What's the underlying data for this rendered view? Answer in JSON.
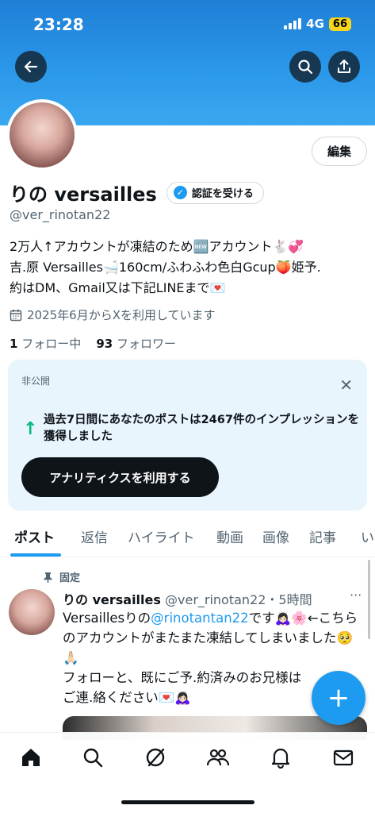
{
  "status_bar": {
    "time": "23:28",
    "network": "4G",
    "battery": "66"
  },
  "header_icons": {
    "back": "back-arrow-icon",
    "search": "search-icon",
    "share": "share-icon"
  },
  "profile": {
    "edit_label": "編集",
    "display_name": "りの versailles",
    "verify_label": "認証を受ける",
    "handle": "@ver_rinotan22",
    "bio_line1": "2万人↑アカウントが凍結のため🆕アカウント🐇💞",
    "bio_line2": "吉.原 Versailles🛁160cm/ふわふわ色白Gcup🍑姫予.",
    "bio_line3": "約はDM、Gmail又は下記LINEまで💌",
    "joined": "2025年6月からXを利用しています",
    "following_count": "1",
    "following_label": "フォロー中",
    "followers_count": "93",
    "followers_label": "フォロワー"
  },
  "analytics_card": {
    "private_label": "非公開",
    "message": "過去7日間にあなたのポストは2467件のインプレッションを獲得しました",
    "button_label": "アナリティクスを利用する"
  },
  "tabs": [
    "ポスト",
    "返信",
    "ハイライト",
    "動画",
    "画像",
    "記事",
    "い"
  ],
  "pinned_post": {
    "pinned_label": "固定",
    "name": "りの versailles",
    "handle_time": "@ver_rinotan22・5時間",
    "more": "···",
    "text_before": "Versaillesりの",
    "mention": "@rinotantan22",
    "text_after": "です🙇🏻‍♀️🌸←こちらのアカウントがまたまた凍結してしまいました🥺🙏🏻",
    "text_line2": "フォローと、既にご予.約済みのお兄様は",
    "text_line3": "ご連.絡ください💌🙇🏻‍♀️"
  },
  "fab": {
    "label": "+"
  },
  "bottom_nav": [
    "home-icon",
    "search-icon",
    "grok-icon",
    "communities-icon",
    "notifications-icon",
    "messages-icon"
  ],
  "colors": {
    "accent": "#1d9bf0",
    "banner": "#2a97e9",
    "green_arrow": "#00ba7c",
    "card_bg": "#e8f5fd"
  }
}
